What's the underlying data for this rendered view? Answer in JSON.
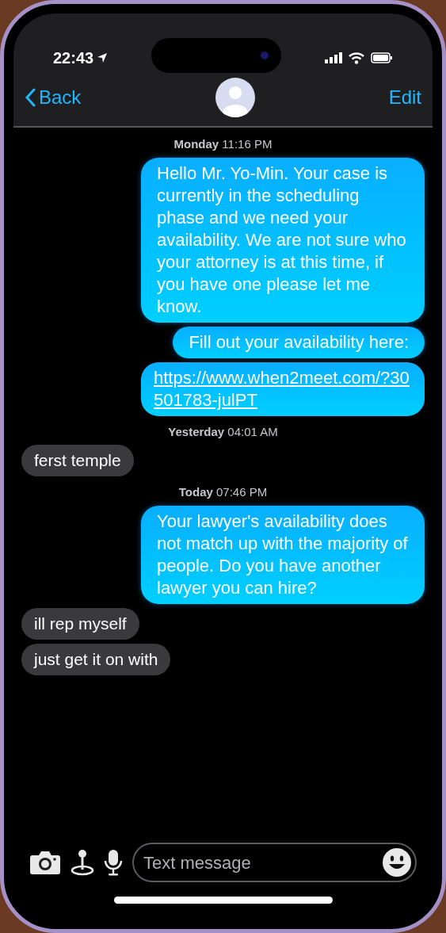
{
  "status_bar": {
    "time": "22:43"
  },
  "nav": {
    "back": "Back",
    "edit": "Edit"
  },
  "messages": [
    {
      "kind": "timestamp",
      "text": "**Monday** 11:16 PM"
    },
    {
      "kind": "sent",
      "text": "Hello Mr. Yo-Min. Your case is currently in the scheduling phase and we need your availability. We are not sure who your attorney is at this time, if you have one please let me know."
    },
    {
      "kind": "sent",
      "text": "Fill out your availability here:"
    },
    {
      "kind": "link",
      "text": "https://www.when2meet.com/?30501783-julPT"
    },
    {
      "kind": "timestamp",
      "text": "**Yesterday** 04:01 AM"
    },
    {
      "kind": "received",
      "text": "ferst temple"
    },
    {
      "kind": "timestamp",
      "text": "**Today** 07:46 PM"
    },
    {
      "kind": "sent",
      "text": "Your lawyer's availability does not match up with the majority of people. Do you have another lawyer you can hire?"
    },
    {
      "kind": "received",
      "text": "ill rep myself"
    },
    {
      "kind": "received",
      "text": "just get it on with"
    }
  ],
  "composer": {
    "placeholder": "Text message"
  }
}
